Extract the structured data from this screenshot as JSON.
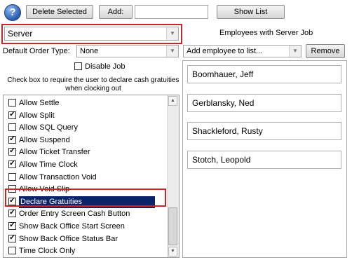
{
  "toolbar": {
    "help_icon": "question-mark",
    "delete_selected_label": "Delete Selected",
    "add_label": "Add:",
    "add_value": "",
    "show_list_label": "Show List"
  },
  "job": {
    "selected": "Server"
  },
  "employees_header": "Employees with Server Job",
  "order_type": {
    "label": "Default Order Type:",
    "value": "None"
  },
  "add_employee": {
    "placeholder": "Add employee to list...",
    "remove_label": "Remove"
  },
  "disable_job": {
    "label": "Disable Job",
    "checked": false
  },
  "instructions": "Check box to require the user to declare cash gratuities when clocking out",
  "permissions": [
    {
      "label": "Allow Settle",
      "checked": false
    },
    {
      "label": "Allow Split",
      "checked": true
    },
    {
      "label": "Allow SQL Query",
      "checked": false
    },
    {
      "label": "Allow Suspend",
      "checked": true
    },
    {
      "label": "Allow Ticket Transfer",
      "checked": true
    },
    {
      "label": "Allow Time Clock",
      "checked": true
    },
    {
      "label": "Allow Transaction Void",
      "checked": false
    },
    {
      "label": "Allow Void Slip",
      "checked": false
    },
    {
      "label": "Declare Gratuities",
      "checked": true,
      "selected": true
    },
    {
      "label": "Order Entry Screen Cash Button",
      "checked": true
    },
    {
      "label": "Show Back Office Start Screen",
      "checked": true
    },
    {
      "label": "Show Back Office Status Bar",
      "checked": true
    },
    {
      "label": "Time Clock Only",
      "checked": false
    }
  ],
  "employees": [
    {
      "name": "Boomhauer, Jeff"
    },
    {
      "name": "Gerblansky, Ned"
    },
    {
      "name": "Shackleford, Rusty"
    },
    {
      "name": "Stotch, Leopold"
    }
  ],
  "colors": {
    "selection": "#0a246a",
    "highlight_outline": "#c42727",
    "help_icon": "#2a5db0"
  }
}
